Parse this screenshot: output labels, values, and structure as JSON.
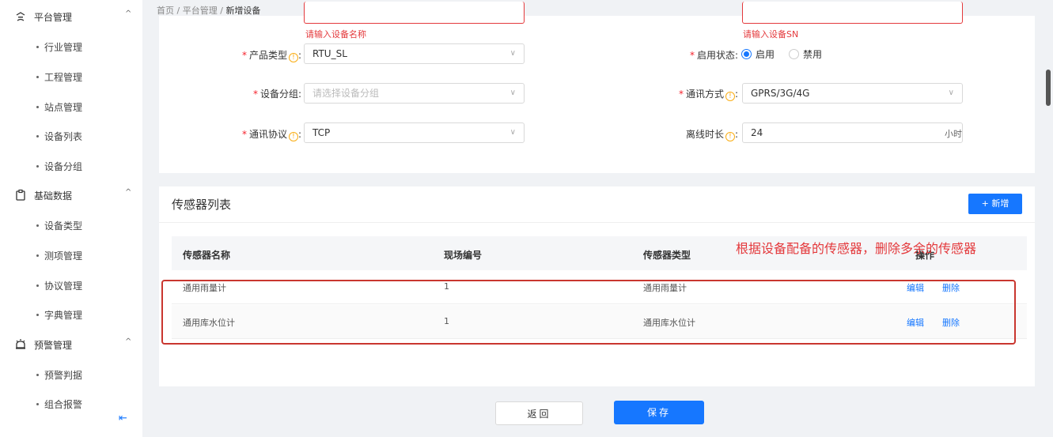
{
  "breadcrumb": {
    "home": "首页",
    "sep": "/",
    "level2": "平台管理",
    "current": "新增设备"
  },
  "sidebar": {
    "groups": [
      {
        "label": "平台管理",
        "icon": "platform-icon",
        "items": [
          "行业管理",
          "工程管理",
          "站点管理",
          "设备列表",
          "设备分组"
        ]
      },
      {
        "label": "基础数据",
        "icon": "clipboard-icon",
        "items": [
          "设备类型",
          "测项管理",
          "协议管理",
          "字典管理"
        ]
      },
      {
        "label": "预警管理",
        "icon": "alarm-icon",
        "items": [
          "预警判据",
          "组合报警"
        ]
      }
    ],
    "chevron": "^",
    "collapse_glyph": "⇤"
  },
  "form": {
    "name_error": "请输入设备名称",
    "sn_error": "请输入设备SN",
    "product_type": {
      "label": "产品类型",
      "value": "RTU_SL"
    },
    "enable_status": {
      "label": "启用状态",
      "options": [
        "启用",
        "禁用"
      ],
      "selected": "启用"
    },
    "device_group": {
      "label": "设备分组",
      "placeholder": "请选择设备分组"
    },
    "comm_mode": {
      "label": "通讯方式",
      "value": "GPRS/3G/4G"
    },
    "comm_protocol": {
      "label": "通讯协议",
      "value": "TCP"
    },
    "offline_duration": {
      "label": "离线时长",
      "value": "24",
      "unit": "小时"
    },
    "colon": ":",
    "required_mark": "*",
    "info_glyph": "!",
    "select_arrow": "∨"
  },
  "sensors": {
    "title": "传感器列表",
    "add_label": "+ 新增",
    "columns": [
      "传感器名称",
      "现场编号",
      "传感器类型",
      "操作"
    ],
    "rows": [
      {
        "name": "通用雨量计",
        "code": "1",
        "type": "通用雨量计"
      },
      {
        "name": "通用库水位计",
        "code": "1",
        "type": "通用库水位计"
      }
    ],
    "edit_label": "编辑",
    "delete_label": "删除",
    "annotation": "根据设备配备的传感器，删除多余的传感器"
  },
  "footer": {
    "back_label": "返回",
    "save_label": "保存"
  },
  "colors": {
    "primary": "#1677ff",
    "error": "#e4393c",
    "highlight": "#c9362f",
    "info": "#faad14"
  }
}
